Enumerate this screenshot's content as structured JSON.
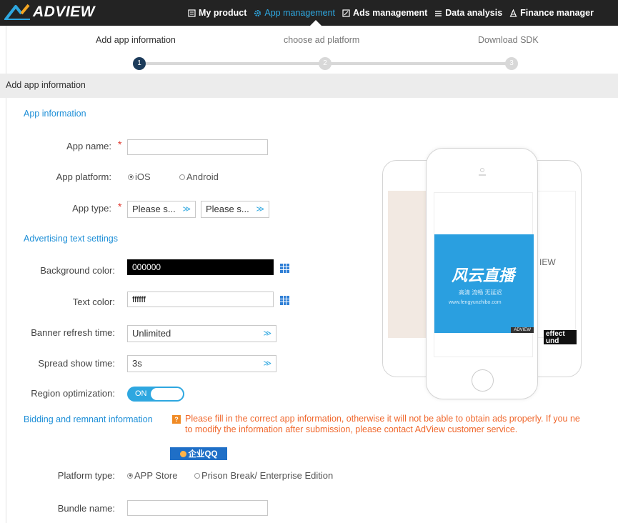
{
  "brand": {
    "name": "ADVIEW"
  },
  "nav": {
    "items": [
      {
        "label": "My product",
        "icon": "product-icon",
        "active": false
      },
      {
        "label": "App management",
        "icon": "gear-icon",
        "active": true
      },
      {
        "label": "Ads management",
        "icon": "ads-icon",
        "active": false
      },
      {
        "label": "Data analysis",
        "icon": "chart-icon",
        "active": false
      },
      {
        "label": "Finance manager",
        "icon": "person-icon",
        "active": false
      }
    ]
  },
  "steps": [
    {
      "label": "Add app information",
      "number": "1",
      "active": true
    },
    {
      "label": "choose ad platform",
      "number": "2",
      "active": false
    },
    {
      "label": "Download SDK",
      "number": "3",
      "active": false
    }
  ],
  "section_title": "Add app information",
  "app_info": {
    "heading": "App information",
    "app_name_label": "App name:",
    "app_name_value": "",
    "platform_label": "App platform:",
    "platform_options": [
      "iOS",
      "Android"
    ],
    "type_label": "App type:",
    "type_select_1": "Please s...",
    "type_select_2": "Please s..."
  },
  "ad_text": {
    "heading": "Advertising text settings",
    "bg_color_label": "Background color:",
    "bg_color_value": "000000",
    "text_color_label": "Text color:",
    "text_color_value": "ffffff",
    "banner_refresh_label": "Banner refresh time:",
    "banner_refresh_value": "Unlimited",
    "spread_show_label": "Spread show time:",
    "spread_show_value": "3s",
    "region_label": "Region optimization:",
    "region_toggle": "ON"
  },
  "bidding": {
    "heading": "Bidding and remnant information",
    "notice_icon": "?",
    "notice_line1": "Please fill in the correct app information, otherwise it will not be able to obtain ads properly. If you ne",
    "notice_line2": "to modify the information after submission, please contact AdView customer service.",
    "qq_label": "企业QQ",
    "platform_type_label": "Platform type:",
    "platform_type_options": [
      "APP Store",
      "Prison Break/ Enterprise Edition"
    ],
    "bundle_label": "Bundle name:",
    "bundle_value": ""
  },
  "preview": {
    "ad_title": "风云直播",
    "ad_subtitle": "高清 流畅 无延迟",
    "ad_url": "www.fengyunzhibo.com",
    "ad_tag": "ADVIEW",
    "back_right_text": "IEW",
    "back_right_caption_1": "effect",
    "back_right_caption_2": "und"
  },
  "colors": {
    "nav_bg": "#232323",
    "accent": "#2ea7e0",
    "active_step": "#1c3b5a",
    "notice": "#f0672c",
    "ad_blue": "#2a9fe0"
  }
}
